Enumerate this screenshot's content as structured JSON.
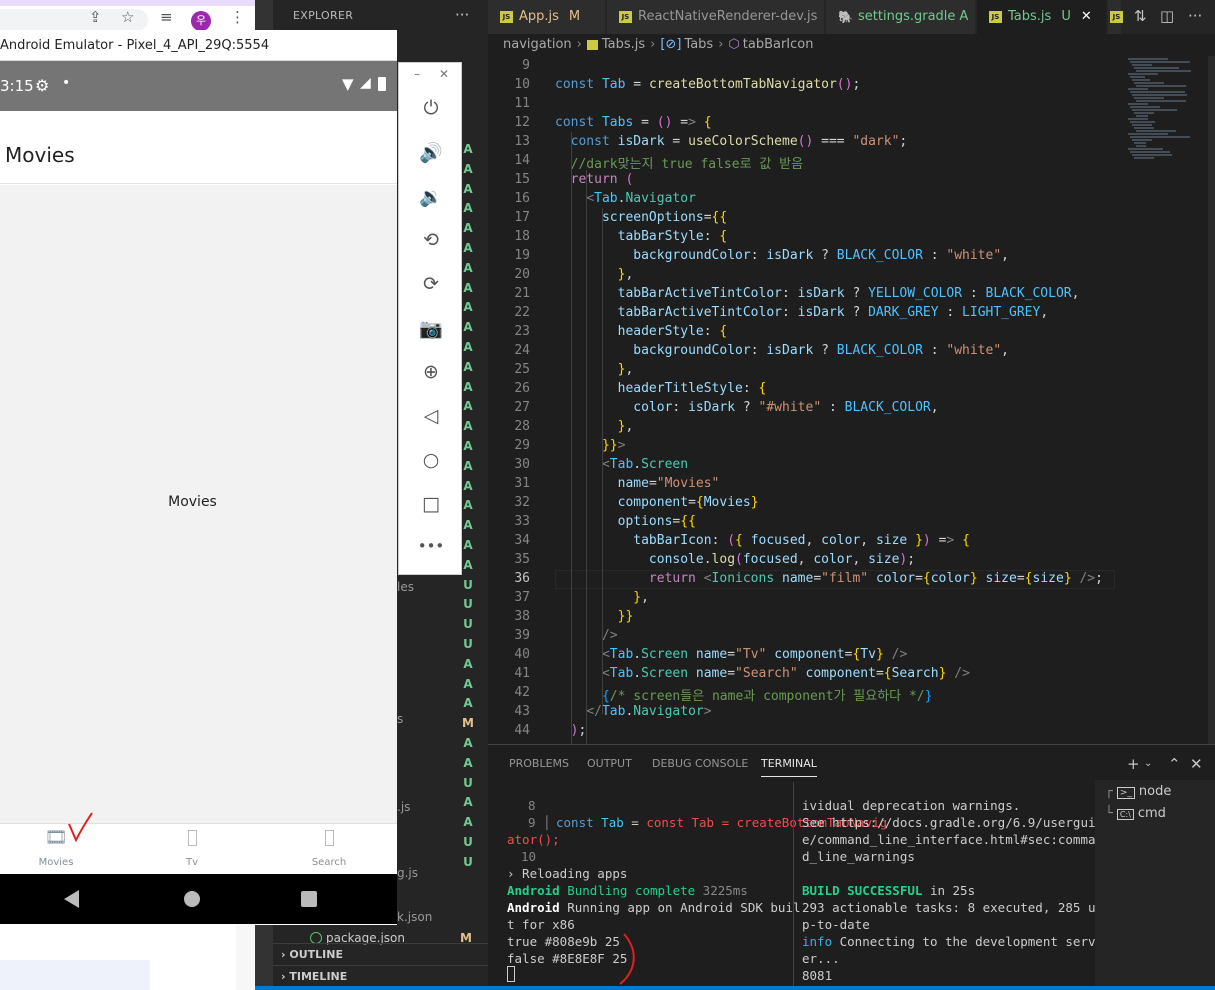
{
  "browser": {
    "window_title": "",
    "avatar_letter": "우"
  },
  "emulator": {
    "title": "Android Emulator - Pixel_4_API_29Q:5554",
    "status_time": "3:15",
    "header_title": "Movies",
    "screen_text": "Movies",
    "tabs": [
      {
        "label": "Movies",
        "icon": "film-icon"
      },
      {
        "label": "Tv",
        "icon": "missing-glyph-icon"
      },
      {
        "label": "Search",
        "icon": "missing-glyph-icon"
      }
    ],
    "toolbar": [
      "power-icon",
      "volume-up-icon",
      "volume-down-icon",
      "rotate-left-icon",
      "rotate-right-icon",
      "camera-icon",
      "zoom-icon",
      "back-icon",
      "home-icon",
      "overview-icon",
      "more-icon"
    ]
  },
  "explorer": {
    "title": "EXPLORER",
    "partial_names": [
      "les",
      "s",
      ".js",
      "g.js",
      "k.json"
    ],
    "package_file": "package.json",
    "package_status": "M",
    "git_status": [
      "A",
      "A",
      "A",
      "A",
      "A",
      "A",
      "A",
      "A",
      "A",
      "A",
      "A",
      "A",
      "A",
      "A",
      "A",
      "A",
      "A",
      "A",
      "A",
      "A",
      "A",
      "A",
      "U",
      "U",
      "U",
      "U",
      "A",
      "A",
      "A",
      "M",
      "A",
      "A",
      "U",
      "A",
      "A",
      "U",
      "U"
    ],
    "outline": "OUTLINE",
    "timeline": "TIMELINE"
  },
  "tabs": [
    {
      "label": "App.js",
      "status": "M",
      "active": false
    },
    {
      "label": "ReactNativeRenderer-dev.js",
      "status": "",
      "active": false
    },
    {
      "label": "settings.gradle",
      "status": "A",
      "active": false
    },
    {
      "label": "Tabs.js",
      "status": "U",
      "active": true
    }
  ],
  "breadcrumbs": [
    "navigation",
    "Tabs.js",
    "Tabs",
    "tabBarIcon"
  ],
  "code": {
    "first_line": 9,
    "current_line": 36,
    "lines": [
      "",
      "const Tab = createBottomTabNavigator();",
      "",
      "const Tabs = () => {",
      "  const isDark = useColorScheme() === \"dark\";",
      "  //dark맞는지 true false로 값 받음",
      "  return (",
      "    <Tab.Navigator",
      "      screenOptions={{",
      "        tabBarStyle: {",
      "          backgroundColor: isDark ? BLACK_COLOR : \"white\",",
      "        },",
      "        tabBarActiveTintColor: isDark ? YELLOW_COLOR : BLACK_COLOR,",
      "        tabBarActiveTintColor: isDark ? DARK_GREY : LIGHT_GREY,",
      "        headerStyle: {",
      "          backgroundColor: isDark ? BLACK_COLOR : \"white\",",
      "        },",
      "        headerTitleStyle: {",
      "          color: isDark ? \"#white\" : BLACK_COLOR,",
      "        },",
      "      }}>",
      "      <Tab.Screen",
      "        name=\"Movies\"",
      "        component={Movies}",
      "        options={{",
      "          tabBarIcon: ({ focused, color, size }) => {",
      "            console.log(focused, color, size);",
      "            return <Ionicons name=\"film\" color={color} size={size} />;",
      "          },",
      "        }}",
      "      />",
      "      <Tab.Screen name=\"Tv\" component={Tv} />",
      "      <Tab.Screen name=\"Search\" component={Search} />",
      "      {/* screen들은 name과 component가 필요하다 */}",
      "    </Tab.Navigator>",
      "  );"
    ]
  },
  "panel": {
    "tabs": [
      "PROBLEMS",
      "OUTPUT",
      "DEBUG CONSOLE",
      "TERMINAL"
    ],
    "active_tab": "TERMINAL",
    "terminals": [
      "node",
      "cmd"
    ],
    "left_term": {
      "ln8": "8",
      "ln9": "9",
      "ln10": "10",
      "code9a": "const Tab = createBottomTabNavig",
      "code9b": "ator();",
      "reload": "› Reloading apps",
      "bundle_a": "Android",
      "bundle_b": " Bundling complete",
      "bundle_c": " 3225ms",
      "running_a": "Android",
      "running_b": " Running app on Android SDK buil",
      "running_c": "t for x86",
      "log1": "true #808e9b 25",
      "log2": "false #8E8E8F 25"
    },
    "right_term": {
      "l1": "ividual deprecation warnings.",
      "l2": "See https://docs.gradle.org/6.9/usergui",
      "l3": "e/command_line_interface.html#sec:comma",
      "l4": "d_line_warnings",
      "build_a": "BUILD SUCCESSFUL",
      "build_b": " in 25s",
      "l6": "293 actionable tasks: 8 executed, 285 u",
      "l7": "p-to-date",
      "info_a": "info",
      "info_b": " Connecting to the development serv",
      "l9": "er...",
      "l10": "8081"
    }
  }
}
